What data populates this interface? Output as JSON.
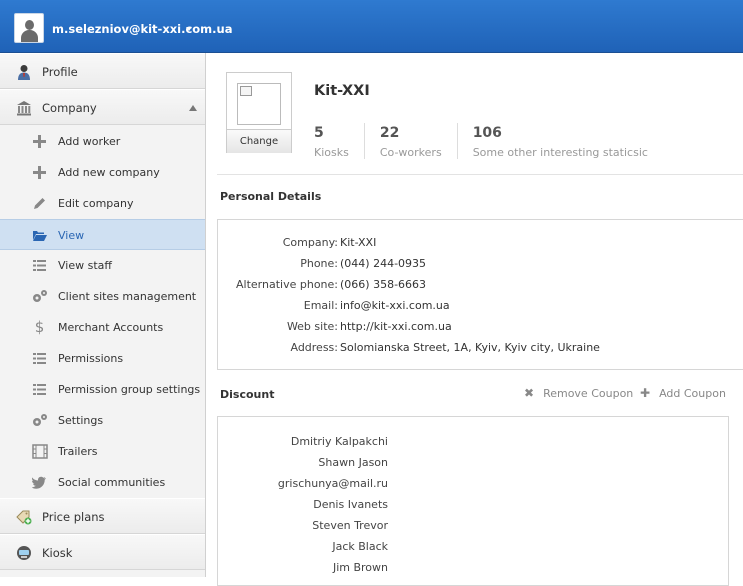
{
  "header": {
    "username": "m.selezniov@kit-xxi.com.ua",
    "avatar_icon": "user-icon"
  },
  "sidebar": {
    "profile": {
      "label": "Profile",
      "icon": "user-tie-icon"
    },
    "company": {
      "label": "Company",
      "icon": "bank-icon"
    },
    "items": [
      {
        "label": "Add worker",
        "icon": "plus-icon"
      },
      {
        "label": "Add new company",
        "icon": "plus-icon"
      },
      {
        "label": "Edit company",
        "icon": "pencil-icon"
      },
      {
        "label": "View",
        "icon": "folder-open-icon",
        "active": true
      },
      {
        "label": "View staff",
        "icon": "list-icon"
      },
      {
        "label": "Client sites management",
        "icon": "gears-icon"
      },
      {
        "label": "Merchant Accounts",
        "icon": "dollar-icon"
      },
      {
        "label": "Permissions",
        "icon": "list-icon"
      },
      {
        "label": "Permission group settings",
        "icon": "list-icon"
      },
      {
        "label": "Settings",
        "icon": "gears-icon"
      },
      {
        "label": "Trailers",
        "icon": "film-icon"
      },
      {
        "label": "Social communities",
        "icon": "twitter-icon"
      }
    ],
    "price_plans": {
      "label": "Price plans",
      "icon": "price-tag-icon"
    },
    "kiosk": {
      "label": "Kiosk",
      "icon": "kiosk-icon"
    }
  },
  "company": {
    "name": "Kit-XXI",
    "change_label": "Change",
    "stats": [
      {
        "value": "5",
        "caption": "Kiosks"
      },
      {
        "value": "22",
        "caption": "Co-workers"
      },
      {
        "value": "106",
        "caption": "Some other interesting staticsic"
      }
    ]
  },
  "personal_details": {
    "title": "Personal Details",
    "rows": [
      {
        "key": "Company:",
        "value": "Kit-XXI"
      },
      {
        "key": "Phone:",
        "value": "(044) 244-0935"
      },
      {
        "key": "Alternative phone:",
        "value": "(066) 358-6663"
      },
      {
        "key": "Email:",
        "value": "info@kit-xxi.com.ua"
      },
      {
        "key": "Web site:",
        "value": "http://kit-xxi.com.ua"
      },
      {
        "key": "Address:",
        "value": "Solomianska Street, 1A, Kyiv, Kyiv city, Ukraine"
      }
    ]
  },
  "discount": {
    "title": "Discount",
    "remove_label": "Remove Coupon",
    "add_label": "Add Coupon",
    "names": [
      "Dmitriy Kalpakchi",
      "Shawn Jason",
      "grischunya@mail.ru",
      "Denis Ivanets",
      "Steven Trevor",
      "Jack Black",
      "Jim Brown"
    ]
  }
}
